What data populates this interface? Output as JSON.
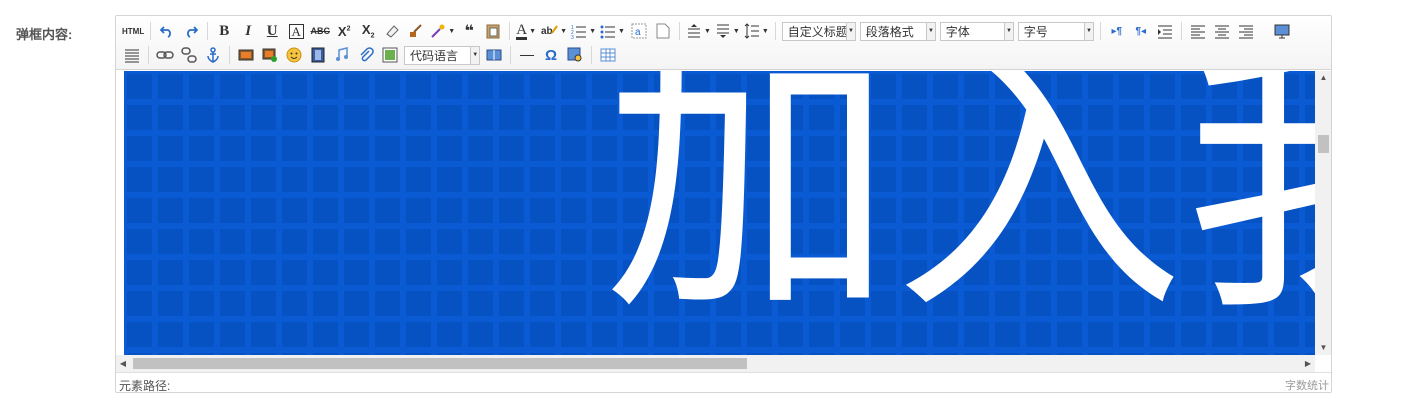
{
  "form": {
    "label": "弹框内容:"
  },
  "toolbar": {
    "html_label": "HTML",
    "custom_title": "自定义标题",
    "paragraph_format": "段落格式",
    "font_family": "字体",
    "font_size": "字号",
    "code_language": "代码语言",
    "omega": "Ω",
    "quote": "❝"
  },
  "content": {
    "visible_text": "加入我",
    "bg_color": "#0a5bd3"
  },
  "status": {
    "element_path": "元素路径:",
    "word_count": "字数统计"
  }
}
